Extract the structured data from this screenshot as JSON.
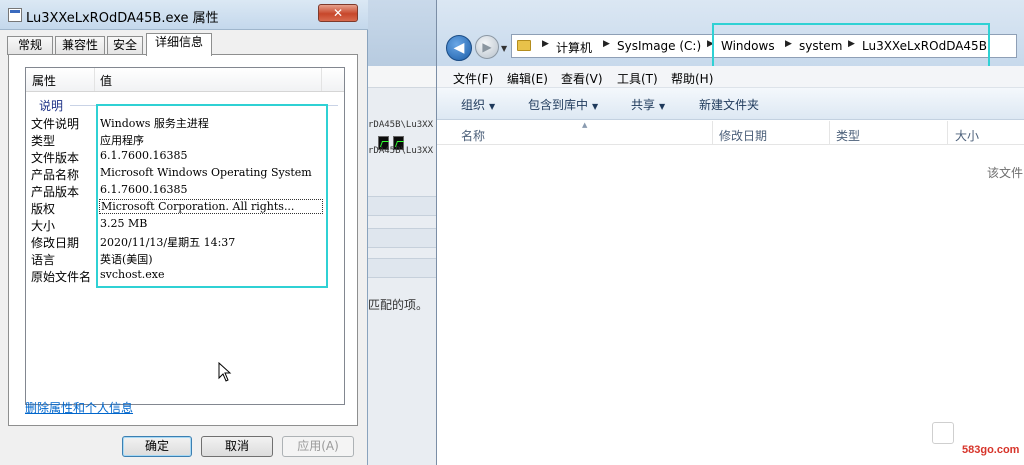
{
  "dialog": {
    "title": "Lu3XXeLxROdDA45B.exe 属性",
    "close_label": "✕",
    "tabs": [
      "常规",
      "兼容性",
      "安全",
      "详细信息"
    ],
    "grid_header": {
      "prop": "属性",
      "value": "值"
    },
    "group_label": "说明",
    "rows": [
      {
        "k": "文件说明",
        "v": "Windows 服务主进程"
      },
      {
        "k": "类型",
        "v": "应用程序"
      },
      {
        "k": "文件版本",
        "v": "6.1.7600.16385"
      },
      {
        "k": "产品名称",
        "v": "Microsoft Windows Operating System"
      },
      {
        "k": "产品版本",
        "v": "6.1.7600.16385"
      },
      {
        "k": "版权",
        "v": "Microsoft Corporation. All rights..."
      },
      {
        "k": "大小",
        "v": "3.25 MB"
      },
      {
        "k": "修改日期",
        "v": "2020/11/13/星期五 14:37"
      },
      {
        "k": "语言",
        "v": "英语(美国)"
      },
      {
        "k": "原始文件名",
        "v": "svchost.exe"
      }
    ],
    "remove_link": "删除属性和个人信息",
    "buttons": {
      "ok": "确定",
      "cancel": "取消",
      "apply": "应用(A)"
    }
  },
  "middle": {
    "path_line_1": "rDA45B\\Lu3XX",
    "path_line_2": "rDA45B\\Lu3XX",
    "match_text": "匹配的项。"
  },
  "explorer": {
    "address": [
      "计算机",
      "SysImage (C:)",
      "Windows",
      "system",
      "Lu3XXeLxROdDA45B"
    ],
    "menu": [
      "文件(F)",
      "编辑(E)",
      "查看(V)",
      "工具(T)",
      "帮助(H)"
    ],
    "commands": [
      "组织",
      "包含到库中",
      "共享",
      "新建文件夹"
    ],
    "columns": [
      "名称",
      "修改日期",
      "类型",
      "大小"
    ],
    "empty_text": "该文件"
  },
  "watermark": "583go.com",
  "colors": {
    "highlight": "#2fd1d4",
    "link": "#0066cc",
    "title_bar": "#c4d8ec"
  }
}
